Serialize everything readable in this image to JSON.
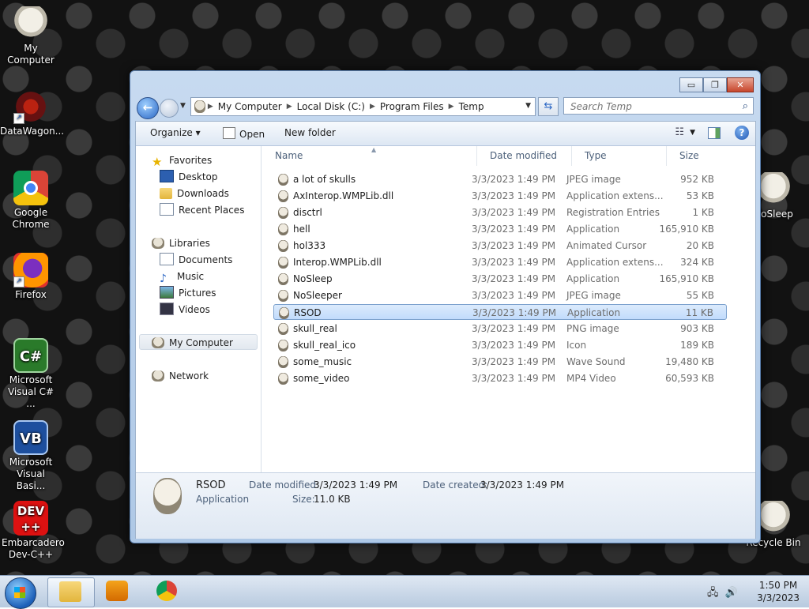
{
  "desktop": {
    "left_icons": [
      {
        "label": "My Computer",
        "icon": "skull-icon"
      },
      {
        "label": "DataWagon...",
        "icon": "datawagon-icon"
      },
      {
        "label": "Google Chrome",
        "icon": "chrome-icon"
      },
      {
        "label": "Firefox",
        "icon": "firefox-icon"
      },
      {
        "label": "Microsoft Visual C# ...",
        "icon": "csharp-icon",
        "glyph": "C#"
      },
      {
        "label": "Microsoft Visual Basi...",
        "icon": "vb-icon",
        "glyph": "VB"
      },
      {
        "label": "Embarcadero Dev-C++",
        "icon": "devcpp-icon",
        "glyph": "DEV ++"
      }
    ],
    "right_icons": [
      {
        "label": "NoSleep",
        "icon": "skull-icon"
      },
      {
        "label": "Recycle Bin",
        "icon": "recycle-bin-icon"
      }
    ]
  },
  "window": {
    "controls": {
      "minimize": "▭",
      "maximize": "❐",
      "close": "✕"
    },
    "breadcrumb": [
      "My Computer",
      "Local Disk (C:)",
      "Program Files",
      "Temp"
    ],
    "search_placeholder": "Search Temp",
    "toolbar": {
      "organize": "Organize ▾",
      "open": "Open",
      "new_folder": "New folder"
    },
    "nav": {
      "favorites": "Favorites",
      "desktop": "Desktop",
      "downloads": "Downloads",
      "recent": "Recent Places",
      "libraries": "Libraries",
      "documents": "Documents",
      "music": "Music",
      "pictures": "Pictures",
      "videos": "Videos",
      "my_computer": "My Computer",
      "network": "Network"
    },
    "columns": {
      "name": "Name",
      "date": "Date modified",
      "type": "Type",
      "size": "Size"
    },
    "files": [
      {
        "name": "a lot of skulls",
        "date": "3/3/2023 1:49 PM",
        "type": "JPEG image",
        "size": "952 KB"
      },
      {
        "name": "AxInterop.WMPLib.dll",
        "date": "3/3/2023 1:49 PM",
        "type": "Application extens...",
        "size": "53 KB"
      },
      {
        "name": "disctrl",
        "date": "3/3/2023 1:49 PM",
        "type": "Registration Entries",
        "size": "1 KB"
      },
      {
        "name": "hell",
        "date": "3/3/2023 1:49 PM",
        "type": "Application",
        "size": "165,910 KB"
      },
      {
        "name": "hol333",
        "date": "3/3/2023 1:49 PM",
        "type": "Animated Cursor",
        "size": "20 KB"
      },
      {
        "name": "Interop.WMPLib.dll",
        "date": "3/3/2023 1:49 PM",
        "type": "Application extens...",
        "size": "324 KB"
      },
      {
        "name": "NoSleep",
        "date": "3/3/2023 1:49 PM",
        "type": "Application",
        "size": "165,910 KB"
      },
      {
        "name": "NoSleeper",
        "date": "3/3/2023 1:49 PM",
        "type": "JPEG image",
        "size": "55 KB"
      },
      {
        "name": "RSOD",
        "date": "3/3/2023 1:49 PM",
        "type": "Application",
        "size": "11 KB"
      },
      {
        "name": "skull_real",
        "date": "3/3/2023 1:49 PM",
        "type": "PNG image",
        "size": "903 KB"
      },
      {
        "name": "skull_real_ico",
        "date": "3/3/2023 1:49 PM",
        "type": "Icon",
        "size": "189 KB"
      },
      {
        "name": "some_music",
        "date": "3/3/2023 1:49 PM",
        "type": "Wave Sound",
        "size": "19,480 KB"
      },
      {
        "name": "some_video",
        "date": "3/3/2023 1:49 PM",
        "type": "MP4 Video",
        "size": "60,593 KB"
      }
    ],
    "selected_index": 8,
    "details": {
      "name": "RSOD",
      "type": "Application",
      "date_modified_label": "Date modified:",
      "date_modified": "3/3/2023 1:49 PM",
      "date_created_label": "Date created:",
      "date_created": "3/3/2023 1:49 PM",
      "size_label": "Size:",
      "size": "11.0 KB"
    }
  },
  "taskbar": {
    "time": "1:50 PM",
    "date": "3/3/2023"
  }
}
